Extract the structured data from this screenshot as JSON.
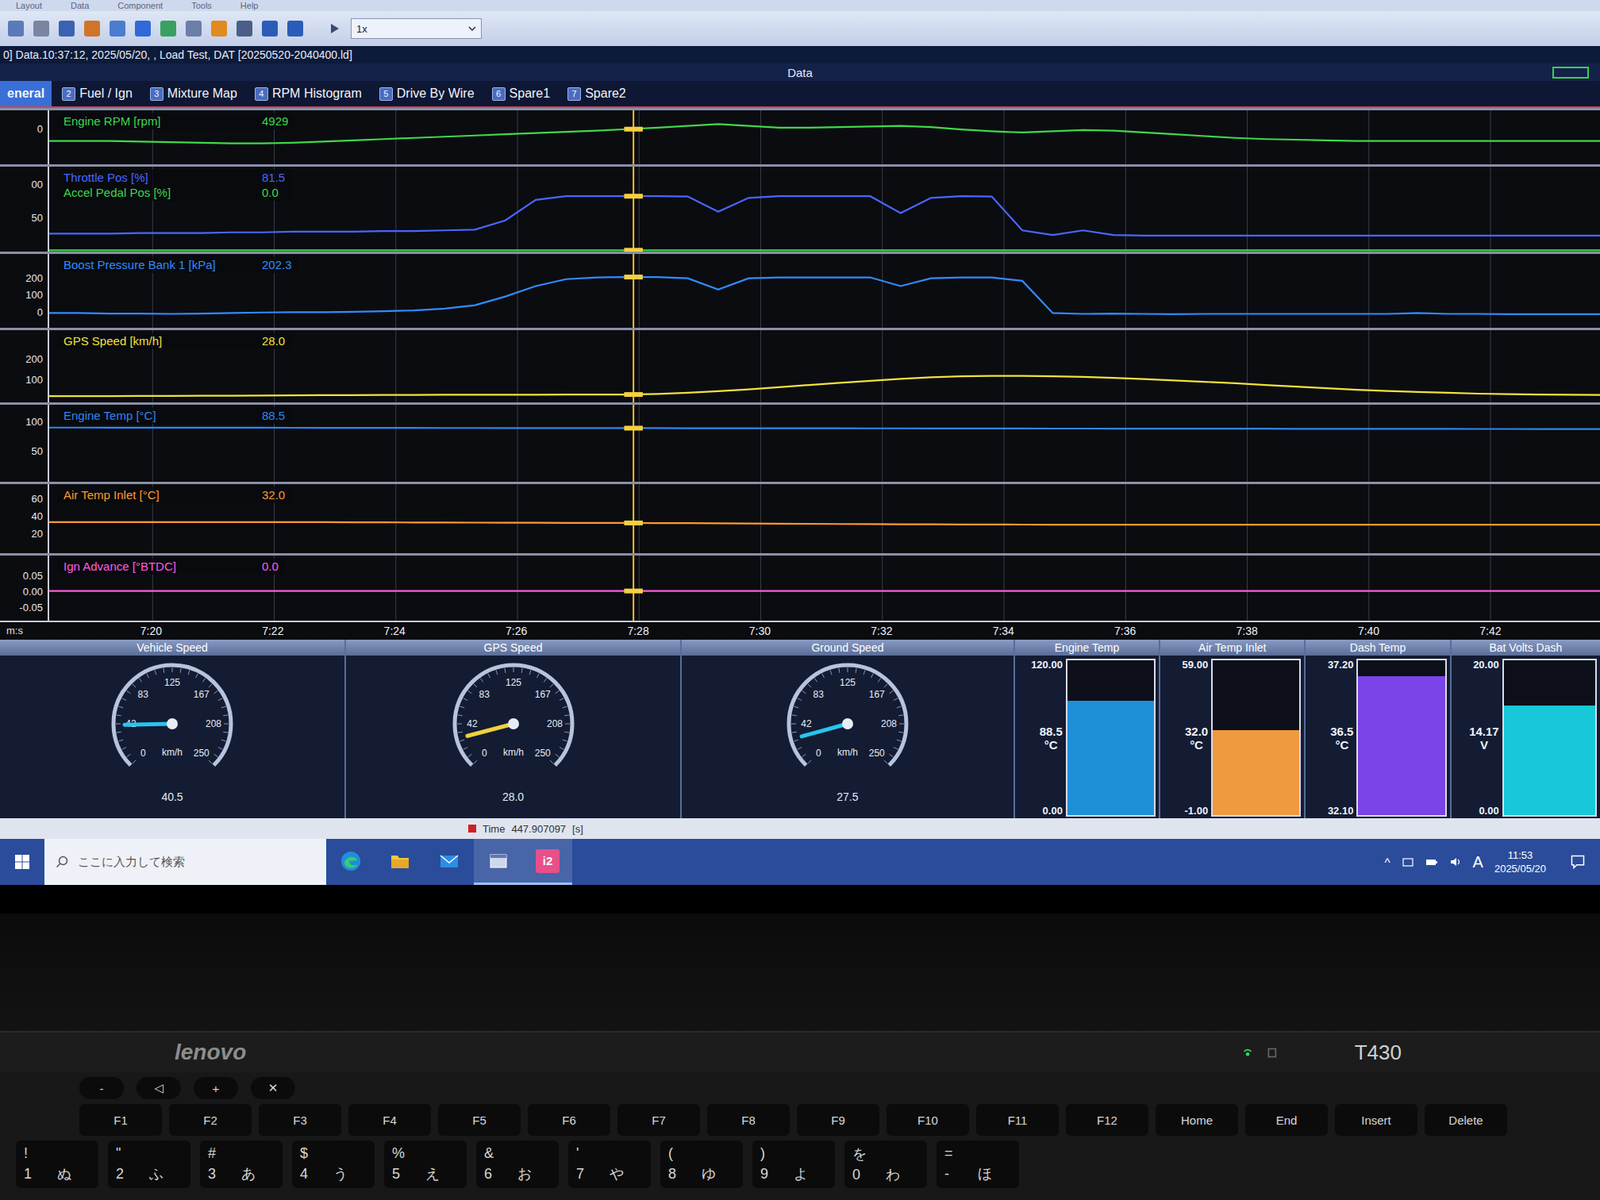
{
  "app_menu": [
    "Layout",
    "Data",
    "Component",
    "Tools",
    "Help"
  ],
  "toolbar": {
    "speed_select": "1x"
  },
  "title_bar": {
    "title": "0] Data.10:37:12, 2025/05/20, , Load Test, DAT [20250520-2040400.ld]"
  },
  "panel_header": {
    "title": "Data"
  },
  "tabs": [
    {
      "num": "",
      "label": "eneral",
      "selected": true
    },
    {
      "num": "2",
      "label": "Fuel / Ign",
      "selected": false
    },
    {
      "num": "3",
      "label": "Mixture Map",
      "selected": false
    },
    {
      "num": "4",
      "label": "RPM Histogram",
      "selected": false
    },
    {
      "num": "5",
      "label": "Drive By Wire",
      "selected": false
    },
    {
      "num": "6",
      "label": "Spare1",
      "selected": false
    },
    {
      "num": "7",
      "label": "Spare2",
      "selected": false
    }
  ],
  "chart": {
    "time_start": 438.3,
    "time_end": 463.8,
    "axis_label": "m:s",
    "time_ticks": [
      "7:20",
      "7:22",
      "7:24",
      "7:26",
      "7:28",
      "7:30",
      "7:32",
      "7:34",
      "7:36",
      "7:38",
      "7:40",
      "7:42"
    ],
    "cursor_time": "447.907097",
    "lanes": [
      {
        "ticks": [
          {
            "text": "0",
            "value": 5000
          }
        ],
        "range": [
          2000,
          6500
        ],
        "series": [
          {
            "label": "Engine RPM [rpm]",
            "value": "4929",
            "color": "#3fd84a",
            "values": [
              3950,
              3950,
              3950,
              3900,
              3850,
              3800,
              3750,
              3750,
              3800,
              3900,
              4000,
              4100,
              4200,
              4300,
              4400,
              4500,
              4600,
              4700,
              4800,
              4929,
              5050,
              5200,
              5350,
              5200,
              5050,
              5050,
              5100,
              5150,
              5200,
              5100,
              4900,
              4750,
              4650,
              4750,
              4850,
              4800,
              4650,
              4500,
              4350,
              4200,
              4100,
              4050,
              4000,
              3950,
              3950,
              3950,
              3950,
              3950,
              3950,
              3950,
              3950,
              3950
            ]
          }
        ]
      },
      {
        "ticks": [
          {
            "text": "00",
            "value": 100
          },
          {
            "text": "50",
            "value": 50
          }
        ],
        "range": [
          -2,
          126
        ],
        "series": [
          {
            "label": "Throttle Pos [%]",
            "value": "81.5",
            "color": "#4a66ff",
            "values": [
              25,
              25,
              25,
              26,
              26,
              26,
              27,
              27,
              28,
              28,
              28,
              29,
              29,
              30,
              31,
              45,
              76,
              81.5,
              81.5,
              81.5,
              81.5,
              81,
              58,
              79,
              81.5,
              81.5,
              81.5,
              81.5,
              56,
              79,
              81.5,
              81,
              30,
              23,
              30,
              23,
              22,
              22,
              22,
              22,
              22,
              22,
              22,
              22,
              22,
              22,
              22,
              22,
              22,
              22,
              22,
              22
            ]
          },
          {
            "label": "Accel Pedal Pos [%]",
            "value": "0.0",
            "color": "#3fd84a",
            "values": [
              0,
              0,
              0,
              0,
              0,
              0,
              0,
              0,
              0,
              0,
              0,
              0,
              0,
              0,
              0,
              0,
              0,
              0,
              0,
              0,
              0,
              0,
              0,
              0,
              0,
              0,
              0,
              0,
              0,
              0,
              0,
              0,
              0,
              0,
              0,
              0,
              0,
              0,
              0,
              0,
              0,
              0,
              0,
              0,
              0,
              0,
              0,
              0,
              0,
              0,
              0,
              0
            ]
          }
        ]
      },
      {
        "ticks": [
          {
            "text": "200",
            "value": 200
          },
          {
            "text": "100",
            "value": 100
          },
          {
            "text": "0",
            "value": 0
          }
        ],
        "range": [
          -90,
          335
        ],
        "series": [
          {
            "label": "Boost Pressure Bank 1 [kPa]",
            "value": "202.3",
            "color": "#2f8cff",
            "values": [
              -5,
              -5,
              -8,
              -8,
              -10,
              -8,
              -5,
              -2,
              0,
              0,
              2,
              5,
              10,
              20,
              40,
              90,
              150,
              190,
              200,
              202,
              202,
              195,
              130,
              195,
              200,
              200,
              200,
              200,
              150,
              195,
              200,
              200,
              180,
              -5,
              -10,
              -8,
              -10,
              -12,
              -10,
              -10,
              -10,
              -10,
              -10,
              -10,
              -10,
              -5,
              -10,
              -10,
              -12,
              -12,
              -12,
              -12
            ]
          }
        ]
      },
      {
        "ticks": [
          {
            "text": "200",
            "value": 200
          },
          {
            "text": "100",
            "value": 100
          }
        ],
        "range": [
          -10,
          338
        ],
        "series": [
          {
            "label": "GPS Speed [km/h]",
            "value": "28.0",
            "color": "#f2e23a",
            "values": [
              20,
              20,
              20,
              21,
              21,
              22,
              22,
              23,
              24,
              25,
              25,
              26,
              26,
              27,
              27,
              27,
              27,
              28,
              28,
              28,
              31,
              36,
              44,
              53,
              63,
              74,
              84,
              94,
              103,
              111,
              116,
              118,
              118,
              116,
              113,
              108,
              102,
              96,
              89,
              82,
              74,
              66,
              58,
              51,
              45,
              40,
              36,
              32,
              30,
              28,
              27,
              26
            ]
          }
        ]
      },
      {
        "ticks": [
          {
            "text": "100",
            "value": 100
          },
          {
            "text": "50",
            "value": 50
          }
        ],
        "range": [
          -2,
          128
        ],
        "series": [
          {
            "label": "Engine Temp [°C]",
            "value": "88.5",
            "color": "#2f86f0",
            "values": [
              89.5,
              89.5,
              89.4,
              89.4,
              89.3,
              89.3,
              89.2,
              89.2,
              89.1,
              89.0,
              89.0,
              88.9,
              88.9,
              88.8,
              88.8,
              88.7,
              88.7,
              88.6,
              88.6,
              88.5,
              88.5,
              88.4,
              88.4,
              88.3,
              88.3,
              88.2,
              88.2,
              88.1,
              88.1,
              88.0,
              88.0,
              87.9,
              87.9,
              87.8,
              87.8,
              87.7,
              87.7,
              87.6,
              87.6,
              87.5,
              87.5,
              87.4,
              87.4,
              87.3,
              87.3,
              87.2,
              87.2,
              87.1,
              87.1,
              87.0,
              87.0,
              86.9
            ]
          }
        ]
      },
      {
        "ticks": [
          {
            "text": "60",
            "value": 60
          },
          {
            "text": "40",
            "value": 40
          },
          {
            "text": "20",
            "value": 20
          }
        ],
        "range": [
          -3,
          77
        ],
        "series": [
          {
            "label": "Air Temp Inlet [°C]",
            "value": "32.0",
            "color": "#ff9a2e",
            "values": [
              33.0,
              33.0,
              33.0,
              33.0,
              33.0,
              33.0,
              33.0,
              33.0,
              33.0,
              33.0,
              32.8,
              32.7,
              32.6,
              32.5,
              32.4,
              32.3,
              32.2,
              32.1,
              32.1,
              32.0,
              31.9,
              31.8,
              31.6,
              31.4,
              31.2,
              31.0,
              30.8,
              30.6,
              30.5,
              30.4,
              30.3,
              30.2,
              30.1,
              30.0,
              30.0,
              30.0,
              30.0,
              30.0,
              30.0,
              30.0,
              30.0,
              30.0,
              30.0,
              30.0,
              30.0,
              30.0,
              30.0,
              30.0,
              30.0,
              30.0,
              30.0,
              30.0
            ]
          }
        ]
      },
      {
        "ticks": [
          {
            "text": "0.05",
            "value": 0.05
          },
          {
            "text": "0.00",
            "value": 0
          },
          {
            "text": "-0.05",
            "value": -0.05
          }
        ],
        "range": [
          -0.094,
          0.1125
        ],
        "series": [
          {
            "label": "Ign Advance [°BTDC]",
            "value": "0.0",
            "color": "#ff5ae0",
            "values": [
              0,
              0,
              0,
              0,
              0,
              0,
              0,
              0,
              0,
              0,
              0,
              0,
              0,
              0,
              0,
              0,
              0,
              0,
              0,
              0,
              0,
              0,
              0,
              0,
              0,
              0,
              0,
              0,
              0,
              0,
              0,
              0,
              0,
              0,
              0,
              0,
              0,
              0,
              0,
              0,
              0,
              0,
              0,
              0,
              0,
              0,
              0,
              0,
              0,
              0,
              0,
              0
            ]
          }
        ]
      }
    ]
  },
  "gauges": {
    "scale_ticks": [
      "0",
      "42",
      "83",
      "125",
      "167",
      "208",
      "250"
    ],
    "dials": [
      {
        "title": "Vehicle Speed",
        "reading": "40.5",
        "unit": "km/h",
        "level": 0.162,
        "needle_color": "#26c6f0"
      },
      {
        "title": "GPS Speed",
        "reading": "28.0",
        "unit": "km/h",
        "level": 0.112,
        "needle_color": "#f0d23a"
      },
      {
        "title": "Ground Speed",
        "reading": "27.5",
        "unit": "km/h",
        "level": 0.11,
        "needle_color": "#26c6f0"
      }
    ],
    "bars": [
      {
        "title": "Engine Temp",
        "max": "120.00",
        "min": "0.00",
        "value": "88.5",
        "unit": "°C",
        "level": 0.74,
        "color": "#1e90d8"
      },
      {
        "title": "Air Temp Inlet",
        "max": "59.00",
        "min": "-1.00",
        "value": "32.0",
        "unit": "°C",
        "level": 0.55,
        "color": "#f09a40"
      },
      {
        "title": "Dash Temp",
        "max": "37.20",
        "min": "32.10",
        "value": "36.5",
        "unit": "°C",
        "level": 0.9,
        "color": "#7a44e8"
      },
      {
        "title": "Bat Volts Dash",
        "max": "20.00",
        "min": "0.00",
        "value": "14.17",
        "unit": "V",
        "level": 0.71,
        "color": "#18c8d8"
      }
    ]
  },
  "status": {
    "time_label": "Time",
    "time_unit": "[s]"
  },
  "taskbar": {
    "search_placeholder": "ここに入力して検索",
    "apps": [
      {
        "kind": "edge",
        "label": "",
        "active": false
      },
      {
        "kind": "folder",
        "label": "",
        "active": false
      },
      {
        "kind": "mail",
        "label": "",
        "active": false
      },
      {
        "kind": "window",
        "label": "",
        "active": true
      },
      {
        "kind": "i2",
        "label": "i2",
        "active": true
      }
    ],
    "tray": {
      "chevron": "^",
      "ime": "A",
      "time": "11:53",
      "date": "2025/05/20"
    }
  },
  "laptop": {
    "brand": "lenovo",
    "model": "T430"
  },
  "keyboard": {
    "media_keys": [
      "-",
      "◁",
      "+",
      "✕"
    ],
    "function_keys": [
      "F1",
      "F2",
      "F3",
      "F4",
      "F5",
      "F6",
      "F7",
      "F8",
      "F9",
      "F10",
      "F11",
      "F12",
      "Home",
      "End",
      "Insert",
      "Delete"
    ],
    "number_keys": [
      {
        "shift": "!",
        "main": "1",
        "kana": "ぬ"
      },
      {
        "shift": "\"",
        "main": "2",
        "kana": "ふ"
      },
      {
        "shift": "#",
        "main": "3",
        "kana": "あ"
      },
      {
        "shift": "$",
        "main": "4",
        "kana": "う"
      },
      {
        "shift": "%",
        "main": "5",
        "kana": "え"
      },
      {
        "shift": "&",
        "main": "6",
        "kana": "お"
      },
      {
        "shift": "'",
        "main": "7",
        "kana": "や"
      },
      {
        "shift": "(",
        "main": "8",
        "kana": "ゆ"
      },
      {
        "shift": ")",
        "main": "9",
        "kana": "よ"
      },
      {
        "shift": "を",
        "main": "0",
        "kana": "わ"
      },
      {
        "shift": "=",
        "main": "-",
        "kana": "ほ"
      }
    ]
  }
}
